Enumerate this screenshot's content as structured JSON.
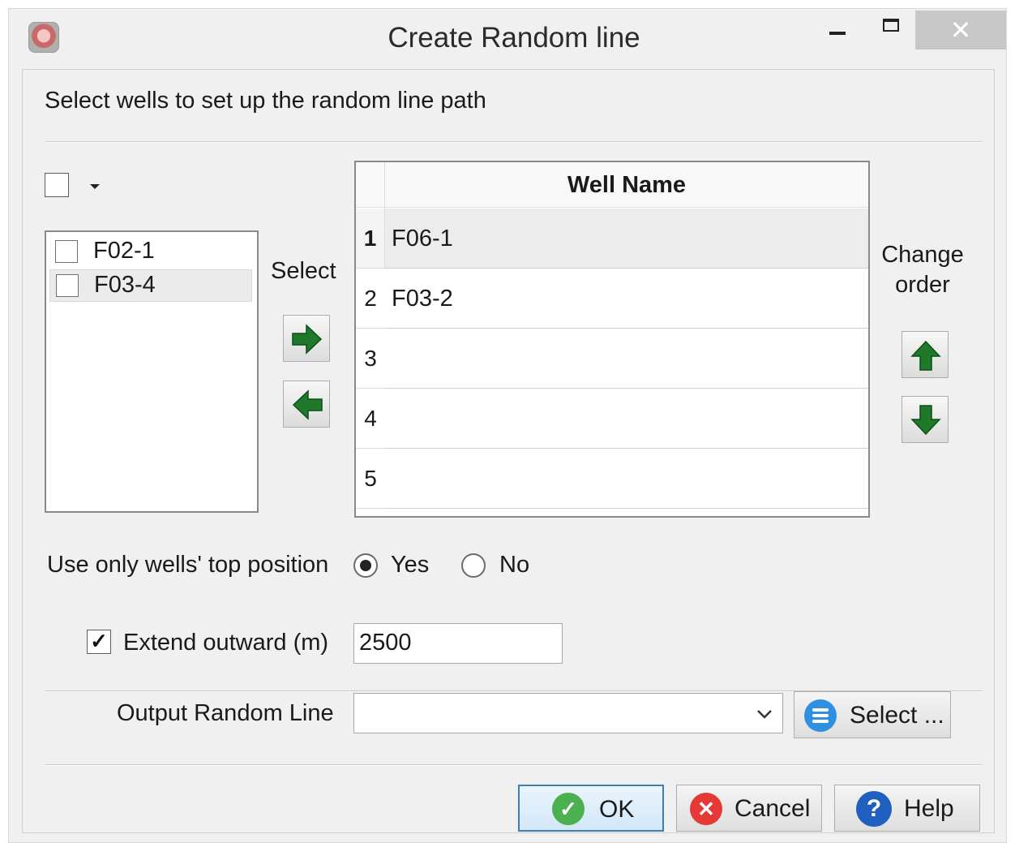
{
  "window": {
    "title": "Create Random line",
    "minimize_glyph": "minimize-icon",
    "maximize_glyph": "maximize-icon",
    "close_glyph": "✕"
  },
  "instruction": "Select wells to set up the random line path",
  "available_wells": [
    {
      "name": "F02-1",
      "checked": false,
      "selected": false
    },
    {
      "name": "F03-4",
      "checked": false,
      "selected": true
    }
  ],
  "select_label": "Select",
  "change_order_label": [
    "Change",
    "order"
  ],
  "table": {
    "column_header": "Well Name",
    "rows": [
      {
        "num": "1",
        "well": "F06-1"
      },
      {
        "num": "2",
        "well": "F03-2"
      },
      {
        "num": "3",
        "well": ""
      },
      {
        "num": "4",
        "well": ""
      },
      {
        "num": "5",
        "well": ""
      }
    ]
  },
  "top_position": {
    "label": "Use only wells' top position",
    "options": [
      "Yes",
      "No"
    ],
    "selected": "Yes"
  },
  "extend": {
    "label": "Extend outward (m)",
    "checked": true,
    "value": "2500"
  },
  "output": {
    "label": "Output Random Line",
    "value": "",
    "select_button": "Select ..."
  },
  "buttons": {
    "ok": "OK",
    "cancel": "Cancel",
    "help": "Help"
  },
  "colors": {
    "arrow_green": "#1e7a2a",
    "ok_green": "#4caf50",
    "cancel_red": "#e53935",
    "help_blue": "#1e5fbf",
    "select_blue": "#2f8fe0"
  }
}
